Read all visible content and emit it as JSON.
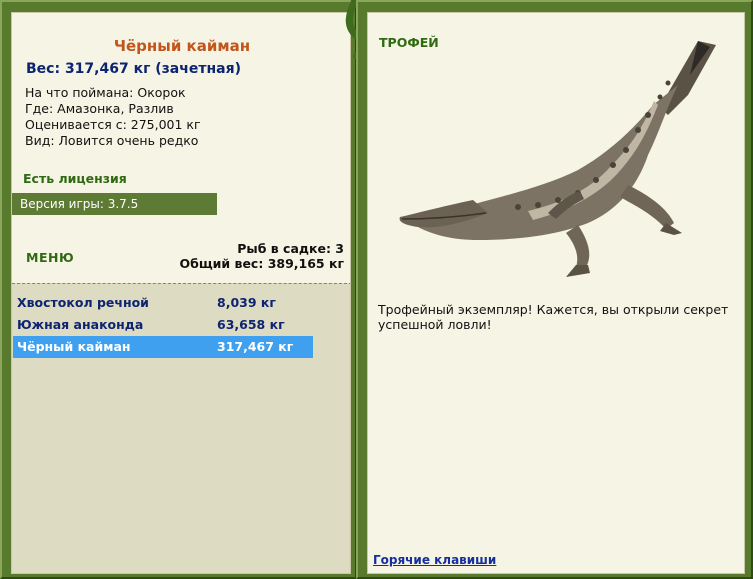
{
  "fish": {
    "title": "Чёрный кайман",
    "weight_line": "Вес: 317,467 кг (зачетная)",
    "bait": "На что поймана: Окорок",
    "location": "Где: Амазонка, Разлив",
    "rated_from": "Оценивается с: 275,001 кг",
    "rarity": "Вид: Ловится очень редко"
  },
  "license": "Есть лицензия",
  "version": "Версия игры: 3.7.5",
  "menu_label": "МЕНЮ",
  "cage": {
    "count_line": "Рыб в садке: 3",
    "total_line": "Общий вес: 389,165 кг"
  },
  "catches": [
    {
      "name": "Хвостокол речной",
      "weight": "8,039 кг",
      "selected": false
    },
    {
      "name": "Южная анаконда",
      "weight": "63,658 кг",
      "selected": false
    },
    {
      "name": "Чёрный кайман",
      "weight": "317,467 кг",
      "selected": true
    }
  ],
  "trophy": {
    "label": "ТРОФЕЙ",
    "text": "Трофейный экземпляр! Кажется, вы открыли секрет успешной ловли!",
    "icon": "caiman-image"
  },
  "hotkeys_link": "Горячие клавиши",
  "colors": {
    "frame": "#577a2c",
    "panel": "#f6f4e4",
    "selected": "#3fa0f0",
    "title": "#c0561b",
    "weight": "#0d2470"
  }
}
